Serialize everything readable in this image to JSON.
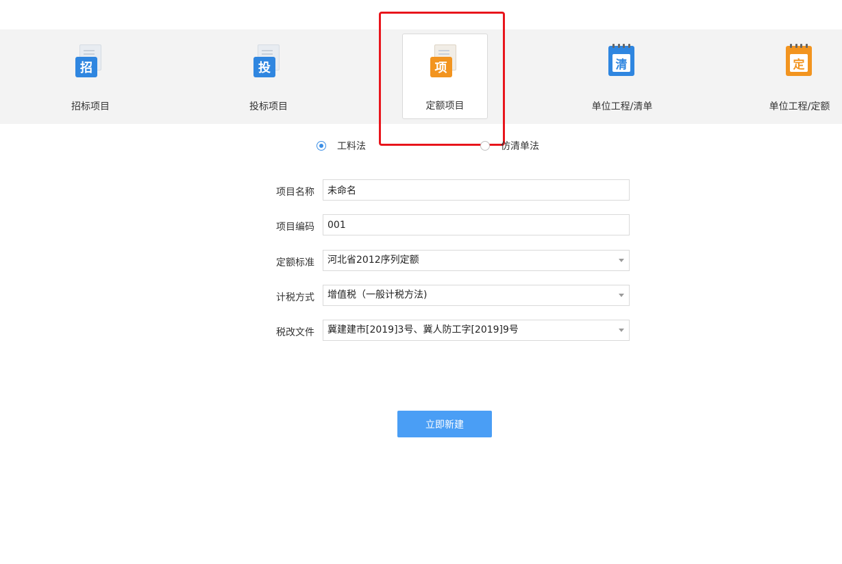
{
  "projects": [
    {
      "label": "招标项目",
      "badge": "招",
      "color": "#2f86e0",
      "icon": "bid-invitation-icon"
    },
    {
      "label": "投标项目",
      "badge": "投",
      "color": "#2f86e0",
      "icon": "bid-submission-icon"
    },
    {
      "label": "定额项目",
      "badge": "项",
      "color": "#f2941f",
      "icon": "quota-project-icon",
      "selected": true
    },
    {
      "label": "单位工程/清单",
      "badge": "清",
      "color": "#2f86e0",
      "icon": "bill-list-icon"
    },
    {
      "label": "单位工程/定额",
      "badge": "定",
      "color": "#f2941f",
      "icon": "quota-icon"
    }
  ],
  "method": {
    "options": [
      "工料法",
      "仿清单法"
    ],
    "selected": "工料法"
  },
  "form": {
    "name_label": "项目名称",
    "name_value": "未命名",
    "code_label": "项目编码",
    "code_value": "001",
    "standard_label": "定额标准",
    "standard_value": "河北省2012序列定额",
    "tax_label": "计税方式",
    "tax_value": "增值税（一般计税方法)",
    "reform_label": "税改文件",
    "reform_value": "冀建建市[2019]3号、冀人防工字[2019]9号"
  },
  "actions": {
    "create_label": "立即新建"
  },
  "colors": {
    "accent": "#4a9ef5",
    "highlight": "#e8141b",
    "blue_icon": "#2f86e0",
    "orange_icon": "#f2941f"
  }
}
